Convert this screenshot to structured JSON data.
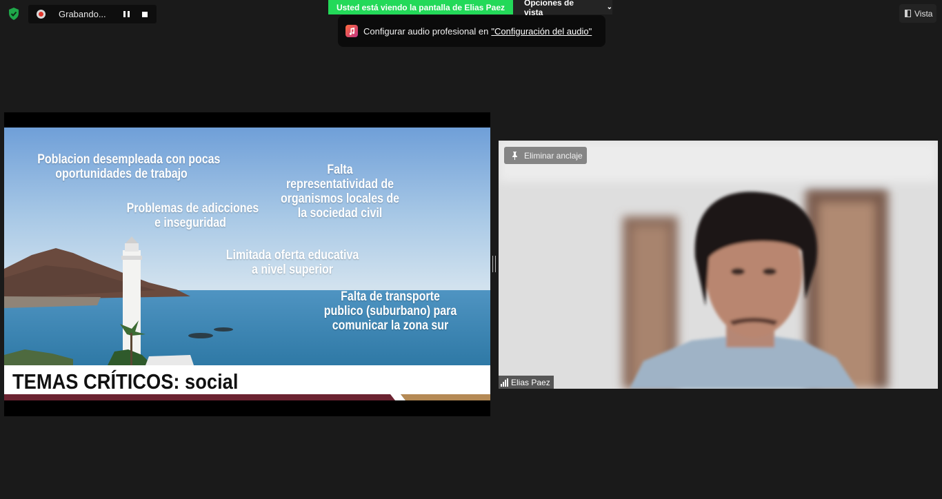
{
  "toolbar": {
    "recording_label": "Grabando...",
    "viewing_banner": "Usted está viendo la pantalla de Elias Paez",
    "view_options_label": "Opciones de vista",
    "view_button_label": "Vista"
  },
  "tooltip": {
    "text": "Configurar audio profesional en",
    "link": "\"Configuración del audio\""
  },
  "slide": {
    "texts": [
      "Poblacion desempleada con pocas\noportunidades de trabajo",
      "Falta\nrepresentatividad de\norganismos locales de\nla sociedad civil",
      "Problemas de adicciones\ne inseguridad",
      "Limitada oferta educativa\na nivel superior",
      "Falta de transporte\npublico (suburbano) para\ncomunicar la zona sur"
    ],
    "title": "TEMAS CRÍTICOS: social"
  },
  "video": {
    "unpin_label": "Eliminar anclaje",
    "participant_name": "Elias Paez"
  },
  "colors": {
    "banner_green": "#23d959",
    "record_red": "#e0352b",
    "stripe_maroon": "#6b2331",
    "stripe_gold": "#b58a55",
    "background": "#1a1a1a"
  }
}
